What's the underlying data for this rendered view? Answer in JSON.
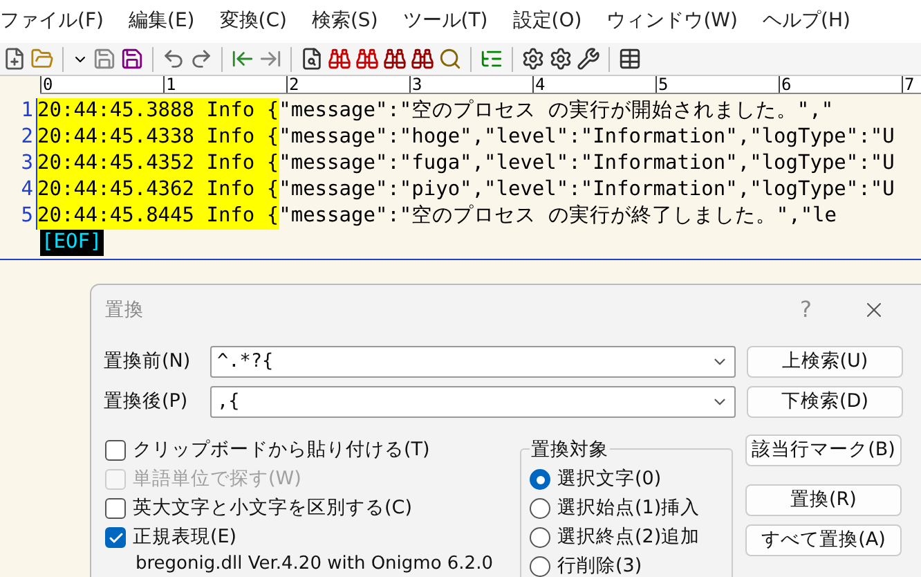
{
  "menu": [
    {
      "label": "ファイル(F)"
    },
    {
      "label": "編集(E)"
    },
    {
      "label": "変換(C)"
    },
    {
      "label": "検索(S)"
    },
    {
      "label": "ツール(T)"
    },
    {
      "label": "設定(O)"
    },
    {
      "label": "ウィンドウ(W)"
    },
    {
      "label": "ヘルプ(H)"
    }
  ],
  "ruler": [
    "0",
    "1",
    "2",
    "3",
    "4",
    "5",
    "6",
    "7"
  ],
  "lines": [
    {
      "number": "1",
      "match": "20:44:45.3888 Info {",
      "rest": "\"message\":\"空のプロセス の実行が開始されました。\",\""
    },
    {
      "number": "2",
      "match": "20:44:45.4338 Info {",
      "rest": "\"message\":\"hoge\",\"level\":\"Information\",\"logType\":\"U"
    },
    {
      "number": "3",
      "match": "20:44:45.4352 Info {",
      "rest": "\"message\":\"fuga\",\"level\":\"Information\",\"logType\":\"U"
    },
    {
      "number": "4",
      "match": "20:44:45.4362 Info {",
      "rest": "\"message\":\"piyo\",\"level\":\"Information\",\"logType\":\"U"
    },
    {
      "number": "5",
      "match": "20:44:45.8445 Info {",
      "rest": "\"message\":\"空のプロセス の実行が終了しました。\",\"le"
    }
  ],
  "eof": "[EOF]",
  "dialog": {
    "title": "置換",
    "help": "?",
    "fields": [
      {
        "label": "置換前(N)",
        "value": "^.*?{",
        "button": "上検索(U)"
      },
      {
        "label": "置換後(P)",
        "value": ",{",
        "button": "下検索(D)"
      }
    ],
    "checkboxes": [
      {
        "label": "クリップボードから貼り付ける(T)",
        "checked": false,
        "disabled": false
      },
      {
        "label": "単語単位で探す(W)",
        "checked": false,
        "disabled": true
      },
      {
        "label": "英大文字と小文字を区別する(C)",
        "checked": false,
        "disabled": false
      },
      {
        "label": "正規表現(E)",
        "checked": true,
        "disabled": false
      }
    ],
    "regex_note": "bregonig.dll Ver.4.20 with Onigmo 6.2.0",
    "target_group": {
      "title": "置換対象",
      "options": [
        {
          "label": "選択文字(0)",
          "selected": true
        },
        {
          "label": "選択始点(1)挿入",
          "selected": false
        },
        {
          "label": "選択終点(2)追加",
          "selected": false
        },
        {
          "label": "行削除(3)",
          "selected": false
        }
      ]
    },
    "buttons": [
      "該当行マーク(B)",
      "置換(R)",
      "すべて置換(A)"
    ]
  }
}
